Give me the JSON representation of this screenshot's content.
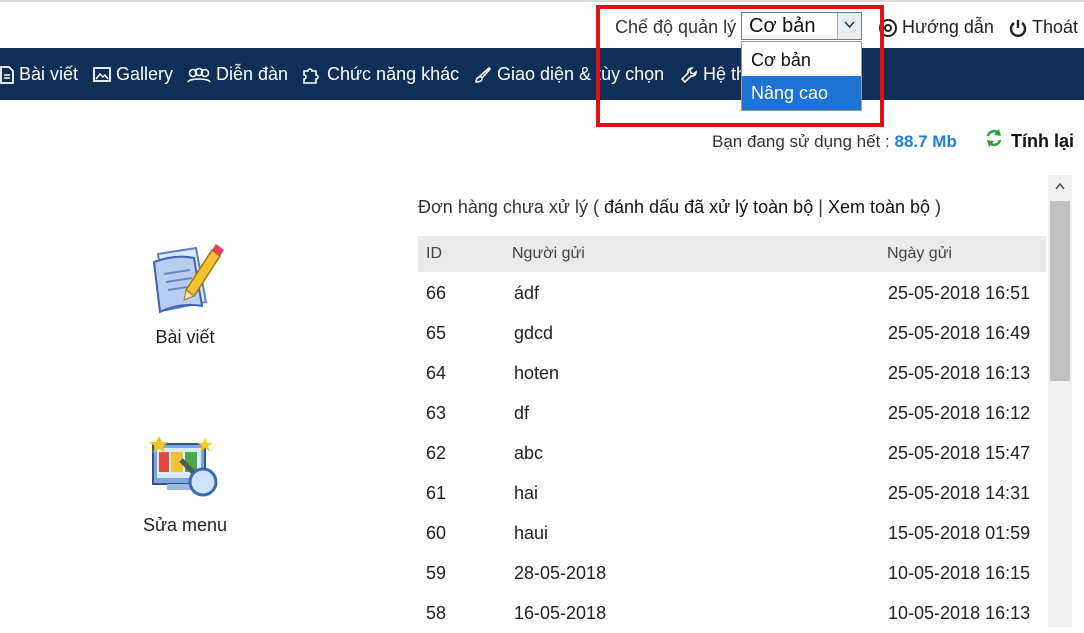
{
  "header": {
    "mode_label": "Chế độ quản lý",
    "mode_selected": "Cơ bản",
    "mode_options": [
      "Cơ bản",
      "Nâng cao"
    ],
    "help_label": "Hướng dẫn",
    "logout_label": "Thoát"
  },
  "nav": {
    "items": [
      {
        "label": "Bài viết",
        "icon": "file-icon"
      },
      {
        "label": "Gallery",
        "icon": "image-icon"
      },
      {
        "label": "Diễn đàn",
        "icon": "users-icon"
      },
      {
        "label": "Chức năng khác",
        "icon": "puzzle-icon"
      },
      {
        "label": "Giao diện & tùy chọn",
        "icon": "brush-icon"
      },
      {
        "label": "Hệ th",
        "icon": "wrench-icon"
      }
    ]
  },
  "usage": {
    "text": "Bạn đang sử dụng hết :",
    "amount": "88.7 Mb",
    "refresh_label": "Tính lại"
  },
  "tiles": [
    {
      "label": "Bài viết",
      "icon": "article-edit-icon"
    },
    {
      "label": "Sửa menu",
      "icon": "menu-edit-icon"
    }
  ],
  "orders": {
    "title": "Đơn hàng chưa xử lý (",
    "mark_all": "đánh dấu đã xử lý toàn bộ",
    "separator": "|",
    "view_all": "Xem toàn bộ",
    "close": ")",
    "columns": [
      "ID",
      "Người gửi",
      "Ngày gửi"
    ],
    "rows": [
      {
        "id": "66",
        "sender": "ádf",
        "date": "25-05-2018 16:51"
      },
      {
        "id": "65",
        "sender": "gdcd",
        "date": "25-05-2018 16:49"
      },
      {
        "id": "64",
        "sender": "hoten",
        "date": "25-05-2018 16:13"
      },
      {
        "id": "63",
        "sender": "df",
        "date": "25-05-2018 16:12"
      },
      {
        "id": "62",
        "sender": "abc",
        "date": "25-05-2018 15:47"
      },
      {
        "id": "61",
        "sender": "hai",
        "date": "25-05-2018 14:31"
      },
      {
        "id": "60",
        "sender": "haui",
        "date": "15-05-2018 01:59"
      },
      {
        "id": "59",
        "sender": "28-05-2018",
        "date": "10-05-2018 16:15"
      },
      {
        "id": "58",
        "sender": "16-05-2018",
        "date": "10-05-2018 16:13"
      }
    ]
  },
  "colors": {
    "nav_bg": "#0e2f57",
    "highlight": "#e01010",
    "selected_option": "#1e74d5",
    "usage_amount": "#1b7fd6",
    "refresh_icon": "#2e9e3e"
  }
}
